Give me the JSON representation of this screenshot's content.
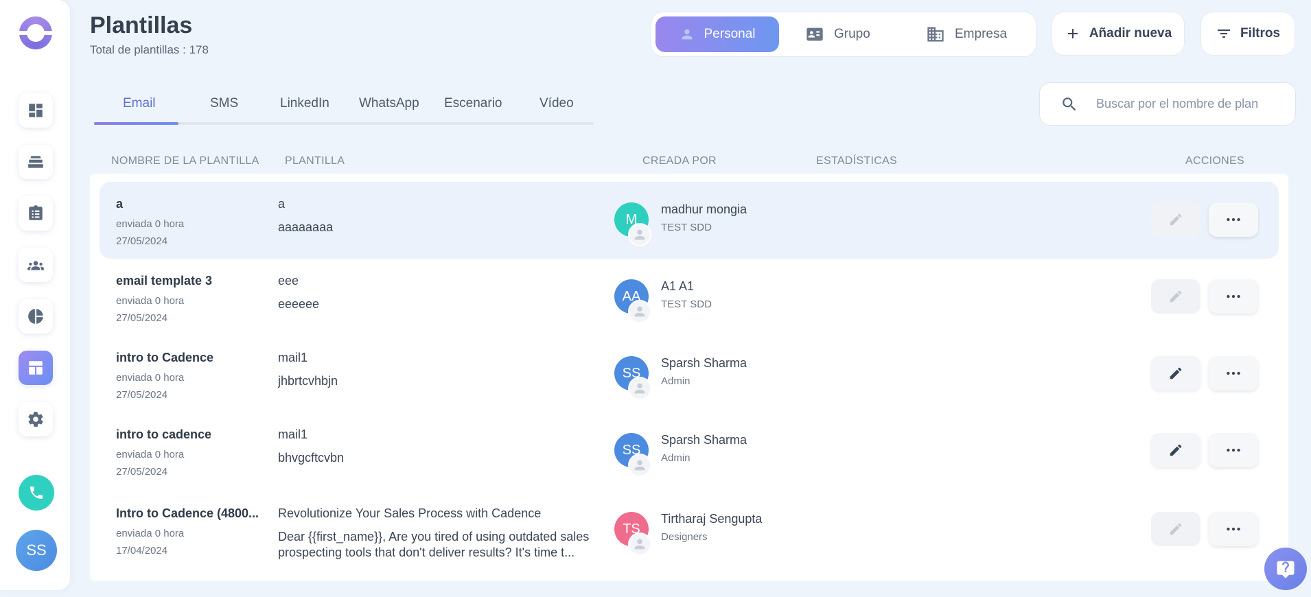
{
  "header": {
    "title": "Plantillas",
    "subtitle": "Total de plantillas : 178"
  },
  "scope": {
    "personal": "Personal",
    "group": "Grupo",
    "company": "Empresa"
  },
  "actions": {
    "add_new": "Añadir nueva",
    "filters": "Filtros"
  },
  "tabs": [
    "Email",
    "SMS",
    "LinkedIn",
    "WhatsApp",
    "Escenario",
    "Vídeo"
  ],
  "search": {
    "placeholder": "Buscar por el nombre de plan"
  },
  "table": {
    "columns": {
      "name": "NOMBRE DE LA PLANTILLA",
      "template": "PLANTILLA",
      "created_by": "CREADA POR",
      "stats": "ESTADÍSTICAS",
      "actions": "ACCIONES"
    },
    "rows": [
      {
        "name": "a",
        "meta": "enviada 0 hora",
        "date": "27/05/2024",
        "subject": "a",
        "body": "aaaaaaaa",
        "initials": "M",
        "creator": "madhur mongia",
        "role": "TEST SDD",
        "avatar_color": "#2fcfbf",
        "editable": false
      },
      {
        "name": "email template 3",
        "meta": "enviada 0 hora",
        "date": "27/05/2024",
        "subject": "eee",
        "body": "eeeeee",
        "initials": "AA",
        "creator": "A1 A1",
        "role": "TEST SDD",
        "avatar_color": "#4d8be0",
        "editable": false
      },
      {
        "name": "intro to Cadence",
        "meta": "enviada 0 hora",
        "date": "27/05/2024",
        "subject": "mail1",
        "body": "jhbrtcvhbjn",
        "initials": "SS",
        "creator": "Sparsh Sharma",
        "role": "Admin",
        "avatar_color": "#4d8be0",
        "editable": true
      },
      {
        "name": "intro to cadence",
        "meta": "enviada 0 hora",
        "date": "27/05/2024",
        "subject": "mail1",
        "body": "bhvgcftcvbn",
        "initials": "SS",
        "creator": "Sparsh Sharma",
        "role": "Admin",
        "avatar_color": "#4d8be0",
        "editable": true
      },
      {
        "name": "Intro to Cadence (4800...",
        "meta": "enviada 0 hora",
        "date": "17/04/2024",
        "subject": "Revolutionize Your Sales Process with Cadence",
        "body": "Dear {{first_name}},   Are you tired of using outdated sales prospecting tools that don't deliver results? It's time t...",
        "initials": "TS",
        "creator": "Tirtharaj Sengupta",
        "role": "Designers",
        "avatar_color": "#f06c8c",
        "editable": false
      }
    ]
  },
  "user": {
    "initials": "SS"
  },
  "icons": {
    "sidebar": [
      "dashboard-icon",
      "inbox-stack-icon",
      "clipboard-icon",
      "people-icon",
      "pie-chart-icon",
      "templates-icon",
      "gear-icon"
    ],
    "phone": "phone-icon",
    "help": "help-chat-icon"
  }
}
